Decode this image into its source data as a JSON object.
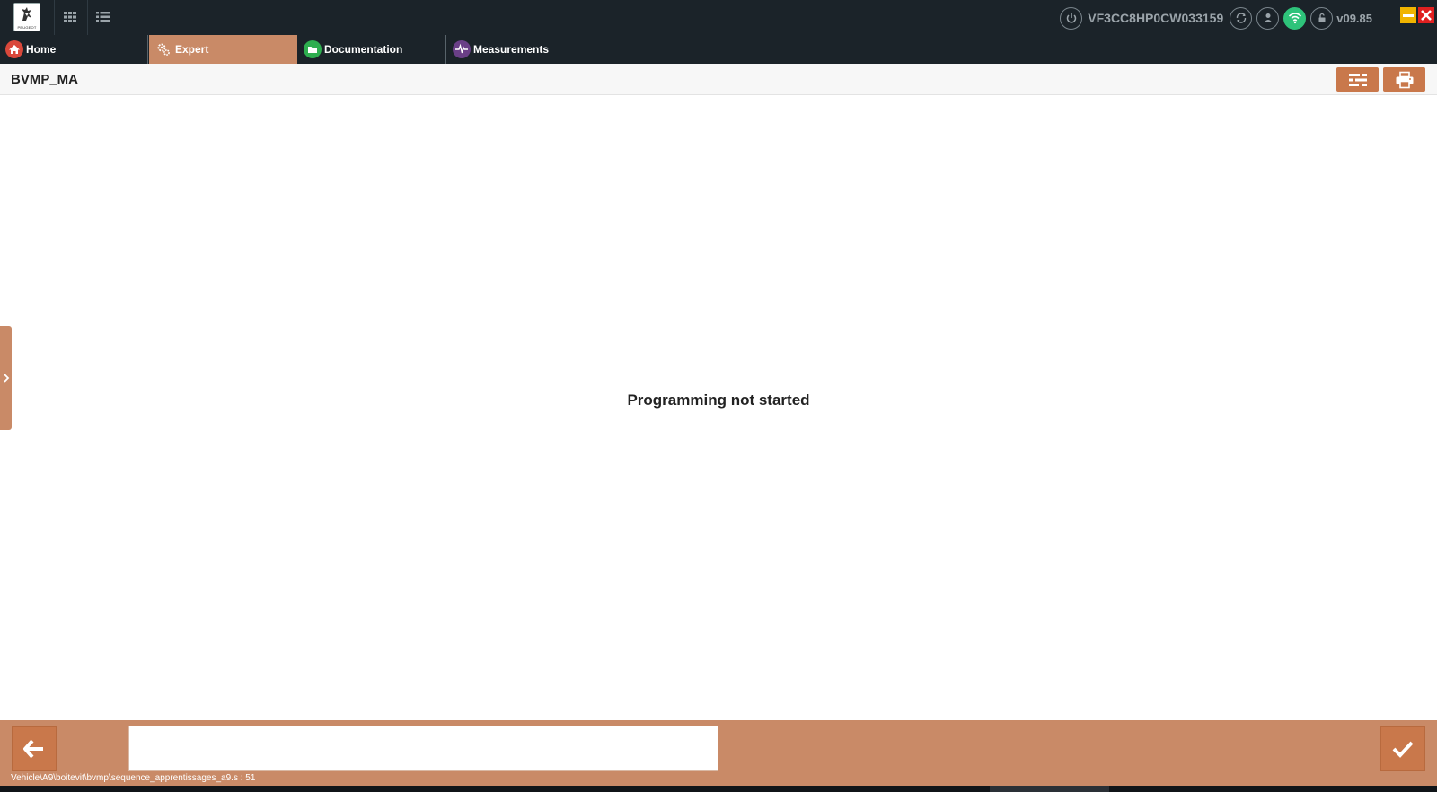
{
  "topbar": {
    "logo_text": "PEUGEOT",
    "vin": "VF3CC8HP0CW033159",
    "version": "v09.85",
    "icons": [
      "grid-icon",
      "list-icon",
      "power-icon",
      "sync-icon",
      "user-icon",
      "wifi-icon",
      "lock-icon"
    ]
  },
  "tabs": [
    {
      "label": "Home",
      "icon": "home-icon",
      "color": "#d9483b"
    },
    {
      "label": "Expert",
      "icon": "gears-icon",
      "color": "#c98a67"
    },
    {
      "label": "Documentation",
      "icon": "folder-icon",
      "color": "#2eae4f"
    },
    {
      "label": "Measurements",
      "icon": "pulse-icon",
      "color": "#6a3f87"
    }
  ],
  "page": {
    "title": "BVMP_MA",
    "status_message": "Programming not started"
  },
  "footer": {
    "path": "Vehicle\\A9\\boitevit\\bvmp\\sequence_apprentissages_a9.s : 51",
    "message": ""
  },
  "colors": {
    "topbar_bg": "#1b2329",
    "accent": "#c98a67",
    "button": "#c9784b",
    "wifi_ok": "#2ec37a"
  }
}
